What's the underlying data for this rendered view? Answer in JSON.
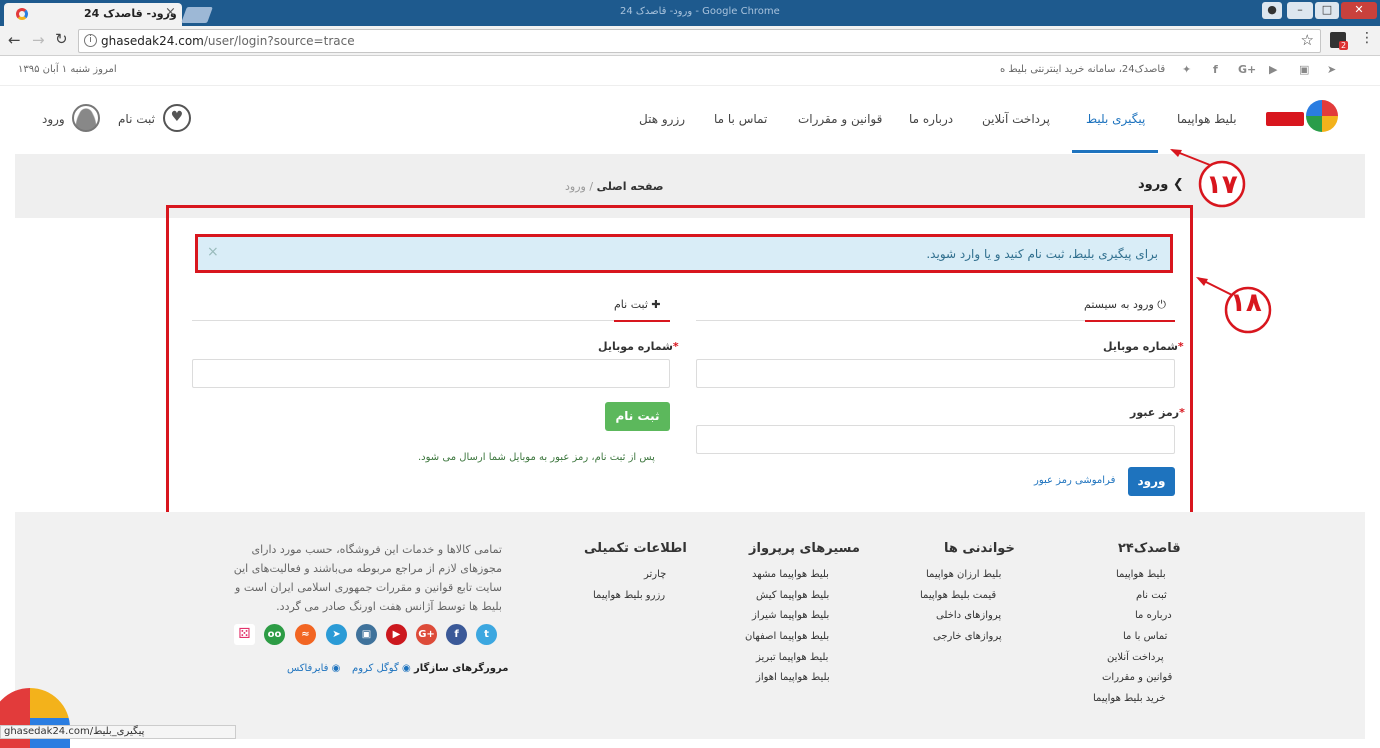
{
  "browser": {
    "tab_title": "ورود- قاصدک 24",
    "tab_close": "×",
    "window_title": "ورود- قاصدک 24 - Google Chrome",
    "url_host": "ghasedak24.com",
    "url_path": "/user/login?source=trace",
    "status_url": "ghasedak24.com/پیگیری_بلیط",
    "extension_badge": "2"
  },
  "topbar": {
    "date_text": "امروز شنبه ۱ آبان ۱۳۹۵",
    "slogan": "قاصدک24، سامانه خرید اینترنتی بلیط ه"
  },
  "nav": {
    "items": [
      "بلیط هواپیما",
      "پیگیری بلیط",
      "پرداخت آنلاین",
      "درباره ما",
      "قوانین و مقررات",
      "تماس با ما",
      "رزرو هتل"
    ],
    "register": "ثبت نام",
    "login": "ورود"
  },
  "breadcrumb": {
    "page_title": "ورود",
    "home": "صفحه اصلی",
    "separator": "/",
    "current": "ورود"
  },
  "annotations": {
    "n17": "۱۷",
    "n18": "۱۸"
  },
  "alert": {
    "text": "برای پیگیری بلیط، ثبت نام کنید و یا وارد شوید.",
    "close": "×"
  },
  "login": {
    "heading": "ورود به سیستم",
    "mobile_label": "شماره موبایل",
    "password_label": "رمز عبور",
    "required": "*",
    "submit": "ورود",
    "forgot": "فراموشی رمز عبور"
  },
  "register": {
    "heading": "ثبت نام",
    "mobile_label": "شماره موبایل",
    "required": "*",
    "submit": "ثبت نام",
    "note": "پس از ثبت نام، رمز عبور به موبایل شما ارسال می شود."
  },
  "footer": {
    "col1": {
      "title": "قاصدک۲۴",
      "links": [
        "بلیط هواپیما",
        "ثبت نام",
        "درباره ما",
        "تماس با ما",
        "پرداخت آنلاین",
        "قوانین و مقررات",
        "خرید بلیط هواپیما"
      ]
    },
    "col2": {
      "title": "خواندنی ها",
      "links": [
        "بلیط ارزان هواپیما",
        "قیمت بلیط هواپیما",
        "پروازهای داخلی",
        "پروازهای خارجی"
      ]
    },
    "col3": {
      "title": "مسیرهای پرپرواز",
      "links": [
        "بلیط هواپیما مشهد",
        "بلیط هواپیما کیش",
        "بلیط هواپیما شیراز",
        "بلیط هواپیما اصفهان",
        "بلیط هواپیما تبریز",
        "بلیط هواپیما اهواز"
      ]
    },
    "col4": {
      "title": "اطلاعات تکمیلی",
      "links": [
        "چارتر",
        "رزرو بلیط هواپیما"
      ]
    },
    "about": [
      "تمامی کالاها و خدمات این فروشگاه، حسب مورد دارای",
      "مجوزهای لازم از مراجع مربوطه می‌باشند و فعالیت‌های این",
      "سایت تابع قوانین و مقررات جمهوری اسلامی ایران است و",
      "بلیط ها توسط آژانس هفت اورنگ صادر می گردد."
    ],
    "browsers_label": "مرورگرهای سازگار",
    "chrome": "گوگل کروم",
    "firefox": "فایرفاکس"
  },
  "colors": {
    "brand_blue": "#1e73be",
    "annotation_red": "#d8161e",
    "success_green": "#5cb85c",
    "alert_bg": "#d9edf7"
  }
}
